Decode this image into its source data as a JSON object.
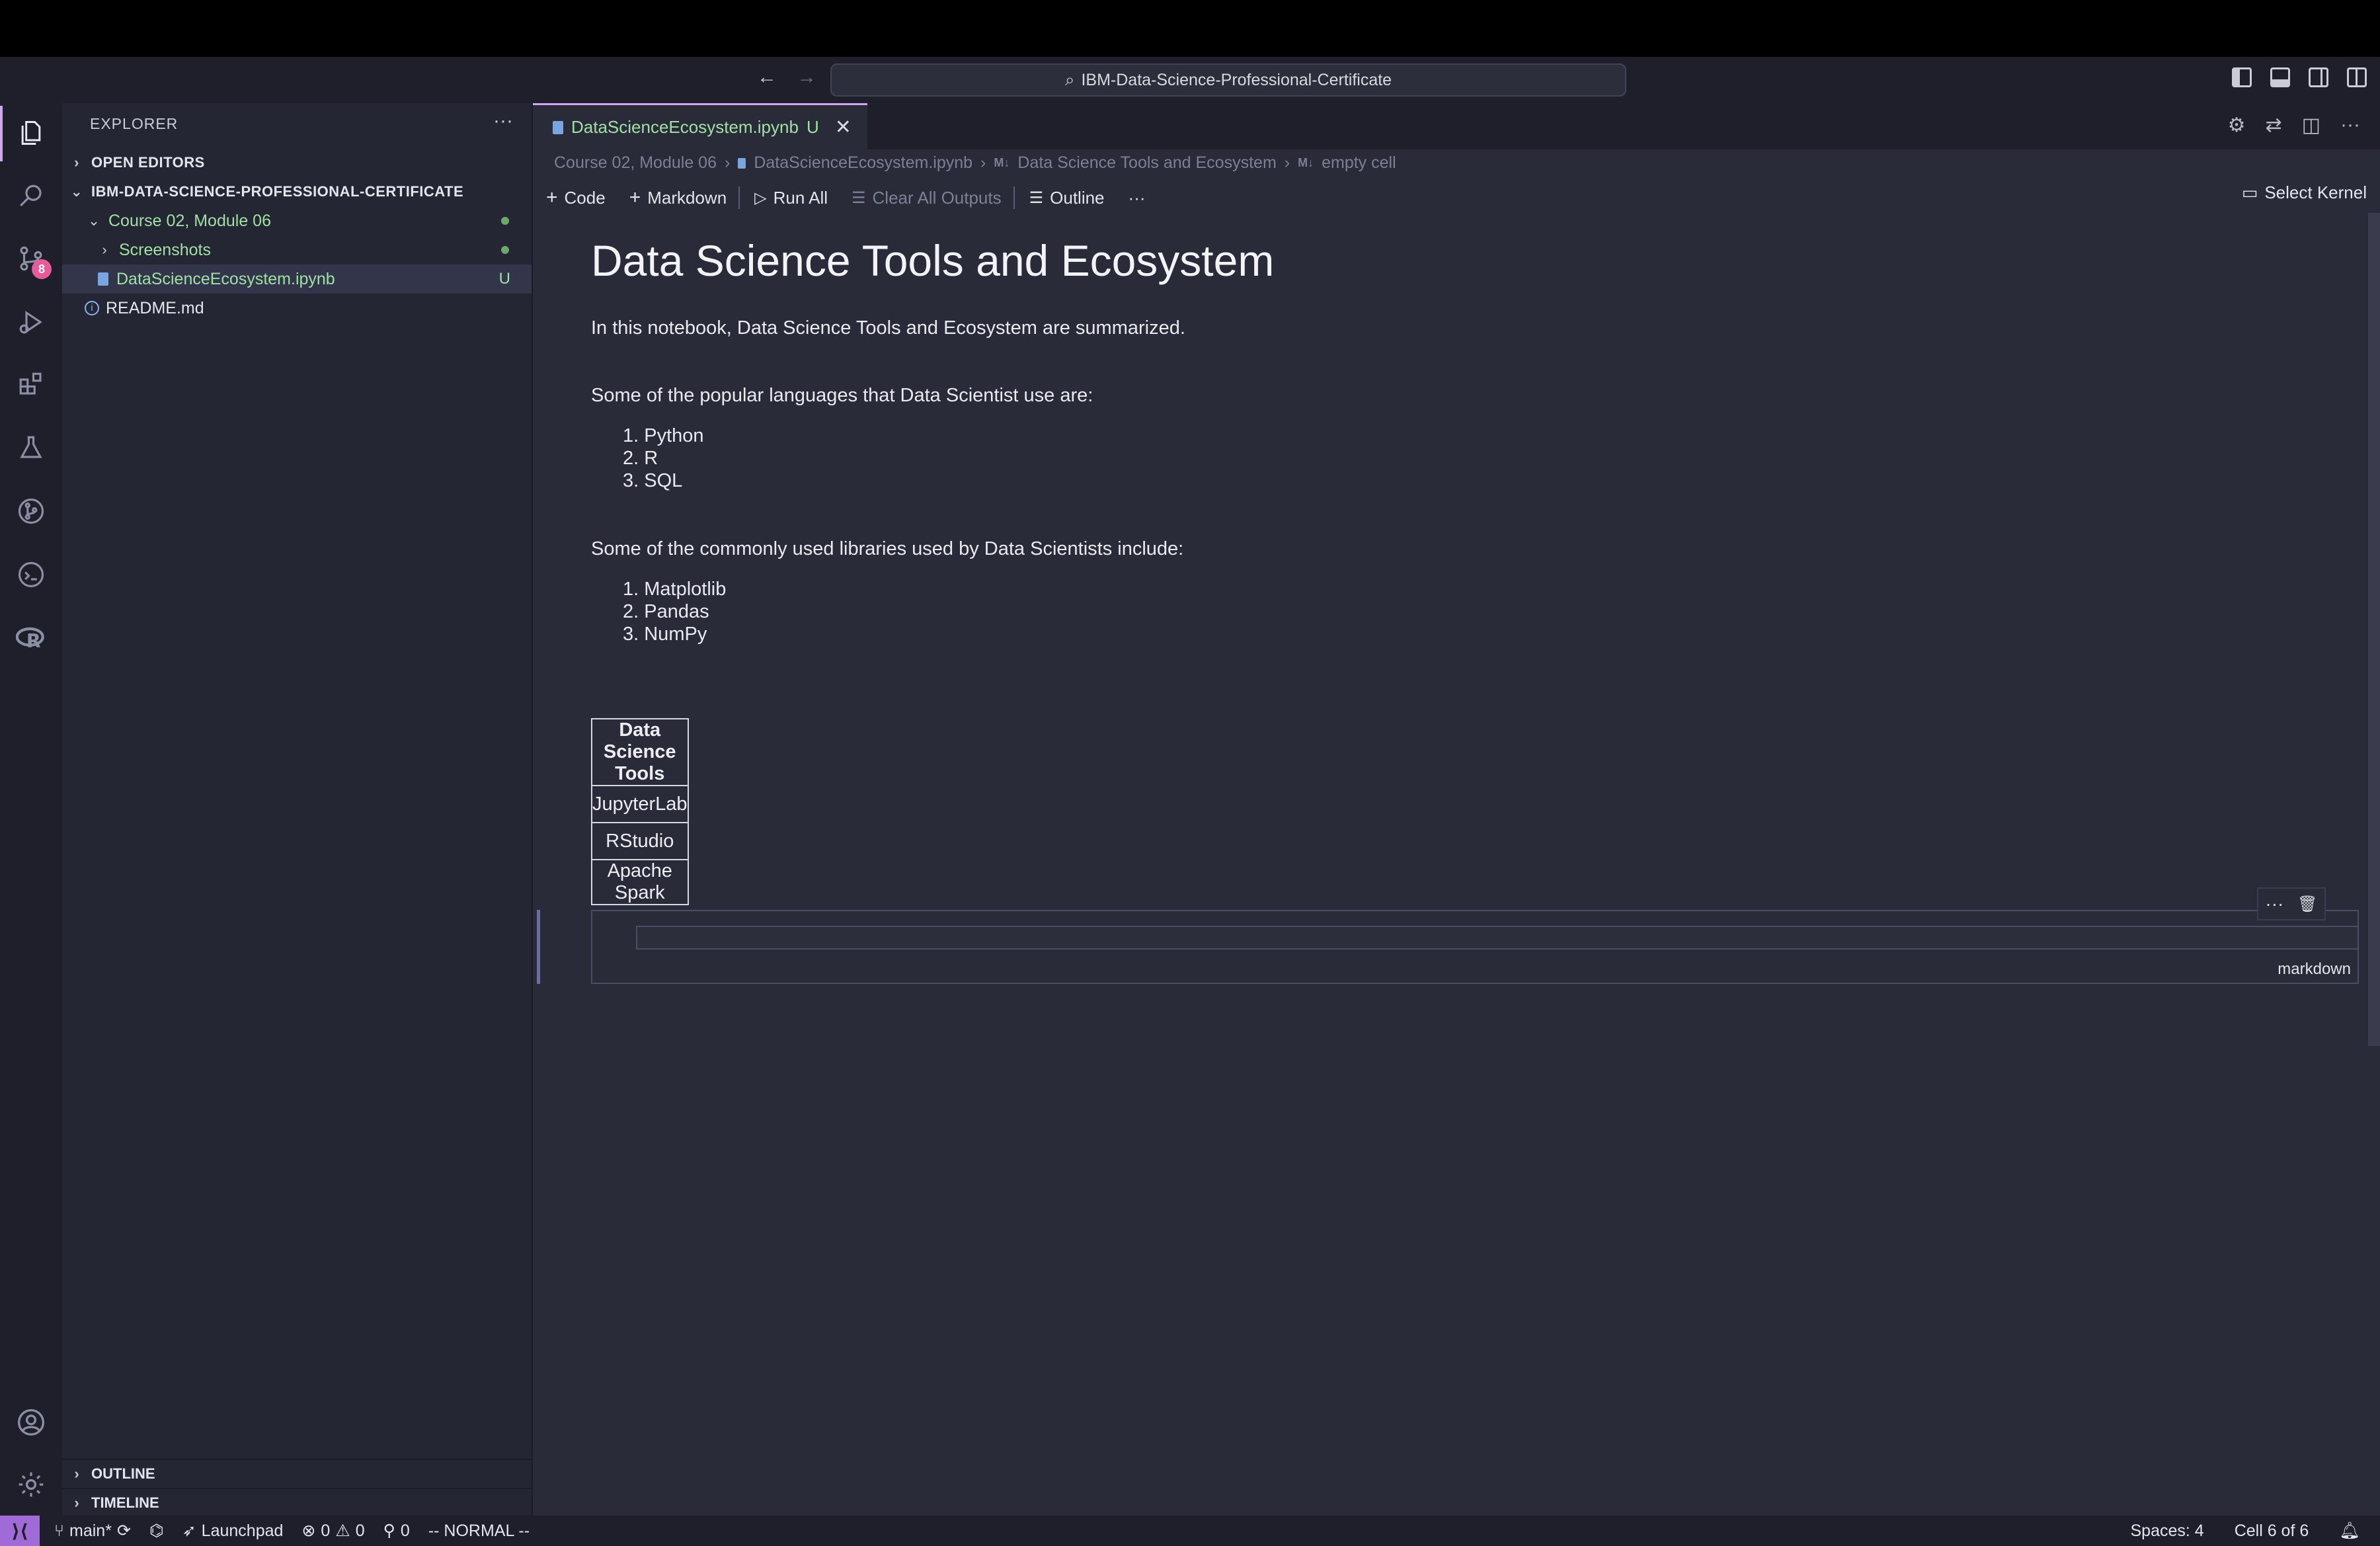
{
  "titlebar": {
    "back": "←",
    "forward": "→",
    "search_text": "IBM-Data-Science-Professional-Certificate"
  },
  "activity": {
    "scm_badge": "8"
  },
  "sidebar": {
    "title": "EXPLORER",
    "more": "···",
    "open_editors": "OPEN EDITORS",
    "project": "IBM-DATA-SCIENCE-PROFESSIONAL-CERTIFICATE",
    "folder": "Course 02, Module 06",
    "subfolder": "Screenshots",
    "notebook": "DataScienceEcosystem.ipynb",
    "notebook_status": "U",
    "readme": "README.md",
    "outline": "OUTLINE",
    "timeline": "TIMELINE"
  },
  "tab": {
    "label": "DataScienceEcosystem.ipynb",
    "status": "U",
    "close": "✕"
  },
  "breadcrumb": {
    "folder": "Course 02, Module 06",
    "file": "DataScienceEcosystem.ipynb",
    "md_tag": "M↓",
    "section": "Data Science Tools and Ecosystem",
    "cell": "empty cell"
  },
  "toolbar": {
    "code": "Code",
    "markdown": "Markdown",
    "run_all": "Run All",
    "clear_outputs": "Clear All Outputs",
    "outline": "Outline",
    "more": "···",
    "select_kernel": "Select Kernel"
  },
  "notebook": {
    "title": "Data Science Tools and Ecosystem",
    "intro": "In this notebook, Data Science Tools and Ecosystem are summarized.",
    "languages_intro": "Some of the popular languages that Data Scientist use are:",
    "languages": [
      "1. Python",
      "2. R",
      "3. SQL"
    ],
    "libraries_intro": "Some of the commonly used libraries used by Data Scientists include:",
    "libraries": [
      "1. Matplotlib",
      "2. Pandas",
      "3. NumPy"
    ],
    "table_header": "Data Science Tools",
    "table_rows": [
      "JupyterLab",
      "RStudio",
      "Apache Spark"
    ],
    "cell_language": "markdown",
    "cell_more": "···",
    "cell_delete": "🗑"
  },
  "statusbar": {
    "branch": "main*",
    "launchpad": "Launchpad",
    "errors": "0",
    "warnings": "0",
    "ports": "0",
    "mode": "-- NORMAL --",
    "spaces": "Spaces: 4",
    "cell_pos": "Cell 6 of 6"
  },
  "colors": {
    "accent": "#d0a7f0",
    "git_untracked": "#9fe0a3",
    "badge": "#e85a9a"
  }
}
